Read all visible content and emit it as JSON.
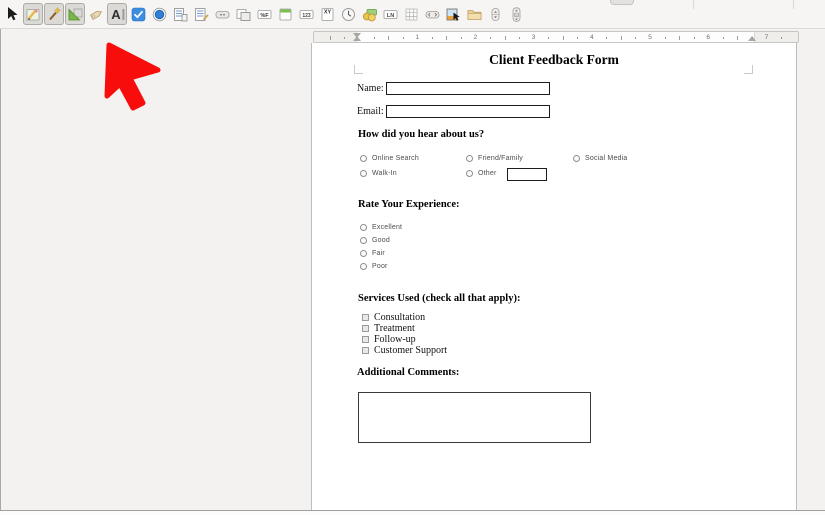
{
  "toolbar": {
    "items": [
      {
        "name": "select",
        "icon": "cursor-arrow-icon",
        "active": false
      },
      {
        "name": "design-mode",
        "icon": "pencil-ruler-icon",
        "active": true
      },
      {
        "name": "form-wizards",
        "icon": "magic-wand-icon",
        "active": true
      },
      {
        "name": "form-design",
        "icon": "set-square-icon",
        "active": true
      },
      {
        "name": "label-field",
        "icon": "tag-icon",
        "active": false
      },
      {
        "name": "text-box",
        "icon": "letter-a-icon",
        "active": true,
        "glyph": "A"
      },
      {
        "name": "check-box",
        "icon": "checkbox-checked-icon",
        "active": false
      },
      {
        "name": "option-button",
        "icon": "radio-button-icon",
        "active": false
      },
      {
        "name": "list-box",
        "icon": "list-box-icon",
        "active": false
      },
      {
        "name": "combo-box",
        "icon": "combo-box-icon",
        "active": false
      },
      {
        "name": "push-button",
        "icon": "push-button-icon",
        "active": false
      },
      {
        "name": "image-button",
        "icon": "image-button-icon",
        "active": false
      },
      {
        "name": "formatted-field",
        "icon": "formatted-field-icon",
        "active": false,
        "glyph": "%F"
      },
      {
        "name": "date-field",
        "icon": "calendar-icon",
        "active": false
      },
      {
        "name": "numeric-field",
        "icon": "numeric-field-icon",
        "active": false,
        "glyph": "123"
      },
      {
        "name": "group-box",
        "icon": "group-box-icon",
        "active": false,
        "glyph": "XY"
      },
      {
        "name": "time-field",
        "icon": "clock-icon",
        "active": false
      },
      {
        "name": "currency-field",
        "icon": "coins-icon",
        "active": false
      },
      {
        "name": "pattern-field",
        "icon": "pattern-field-icon",
        "active": false,
        "glyph": "LN"
      },
      {
        "name": "table-control",
        "icon": "grid-icon",
        "active": false
      },
      {
        "name": "navigation-bar",
        "icon": "navigation-icon",
        "active": false
      },
      {
        "name": "image-control",
        "icon": "image-control-icon",
        "active": false
      },
      {
        "name": "file-selection",
        "icon": "folder-icon",
        "active": false
      },
      {
        "name": "spin-button",
        "icon": "spin-button-icon",
        "active": false
      },
      {
        "name": "scrollbar",
        "icon": "scrollbar-icon",
        "active": false
      }
    ]
  },
  "ruler": {
    "numbers": [
      "1",
      "2",
      "3",
      "4",
      "5",
      "6",
      "7"
    ]
  },
  "pointer": {
    "color": "#f80d0d"
  },
  "form": {
    "title": "Client Feedback Form",
    "fields": {
      "name": {
        "label": "Name:",
        "value": ""
      },
      "email": {
        "label": "Email:",
        "value": ""
      }
    },
    "hear": {
      "heading": "How did you hear about us?",
      "options": [
        "Online Search",
        "Friend/Family",
        "Social Media",
        "Walk-In",
        "Other"
      ],
      "other_value": ""
    },
    "rate": {
      "heading": "Rate Your Experience:",
      "options": [
        "Excellent",
        "Good",
        "Fair",
        "Poor"
      ]
    },
    "services": {
      "heading": "Services Used (check all that apply):",
      "options": [
        "Consultation",
        "Treatment",
        "Follow-up",
        "Customer Support"
      ]
    },
    "comments": {
      "heading": "Additional Comments:",
      "value": ""
    }
  }
}
